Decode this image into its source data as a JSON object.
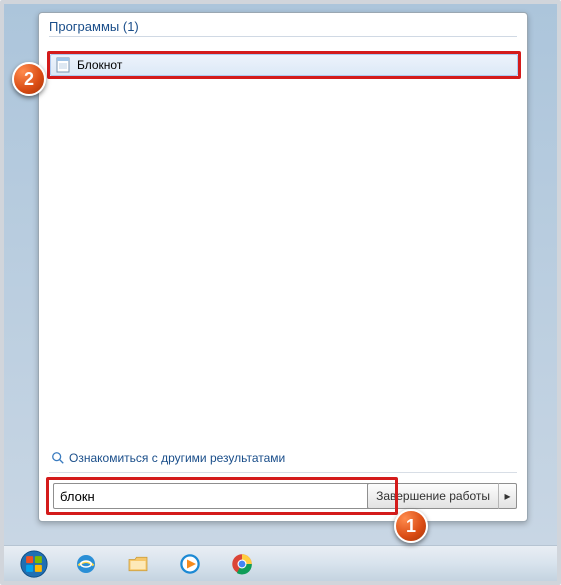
{
  "category": {
    "label": "Программы",
    "count": "(1)"
  },
  "result": {
    "name": "Блокнот"
  },
  "more_results_label": "Ознакомиться с другими результатами",
  "search": {
    "value": "блокн",
    "clear_symbol": "×"
  },
  "shutdown": {
    "label": "Завершение работы",
    "arrow": "▸"
  },
  "callouts": {
    "one": "1",
    "two": "2"
  },
  "taskbar_icons": [
    "start",
    "ie",
    "explorer",
    "wmp",
    "chrome"
  ]
}
